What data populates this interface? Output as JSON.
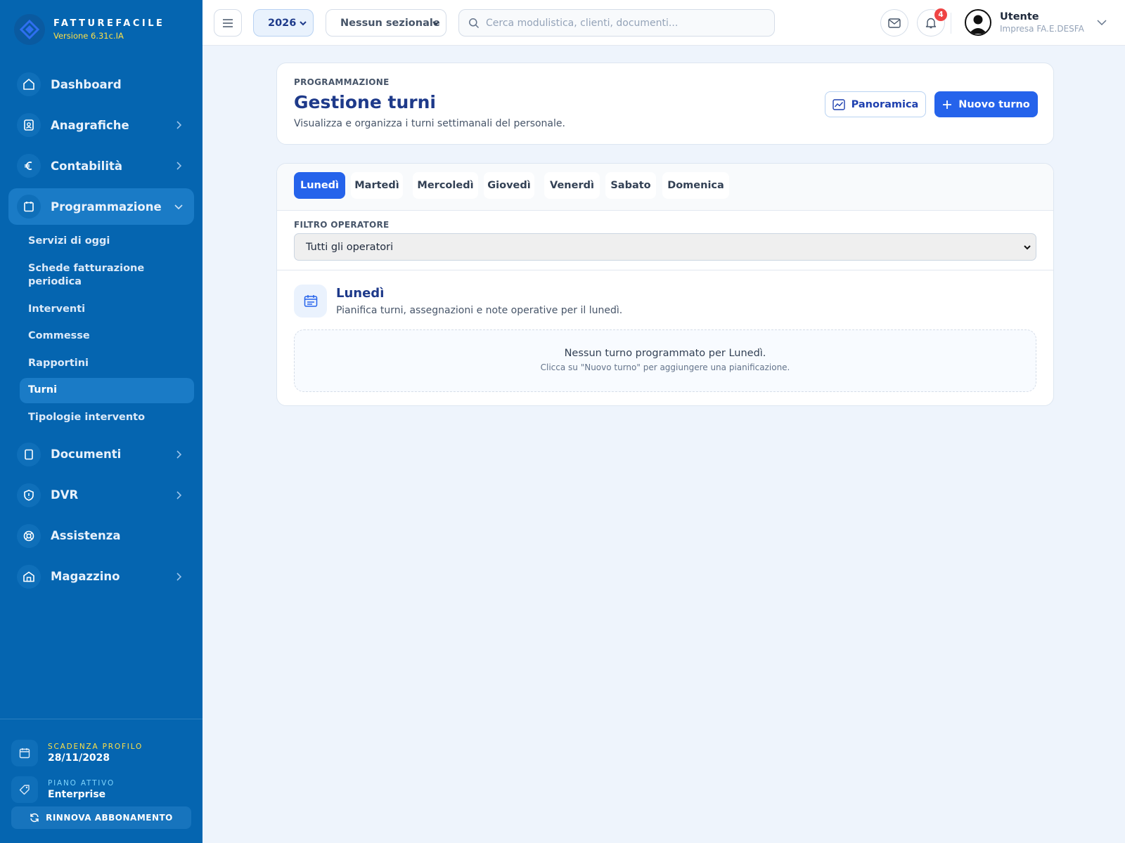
{
  "brand": {
    "name": "FATTUREFACILE",
    "version": "Versione 6.31c.IA"
  },
  "sidebar": {
    "items": [
      {
        "label": "Dashboard",
        "icon": "home-icon"
      },
      {
        "label": "Anagrafiche",
        "icon": "contact-card-icon"
      },
      {
        "label": "Contabilità",
        "icon": "euro-icon"
      },
      {
        "label": "Programmazione",
        "icon": "calendar-icon"
      },
      {
        "label": "Documenti",
        "icon": "document-icon"
      },
      {
        "label": "DVR",
        "icon": "shield-icon"
      },
      {
        "label": "Assistenza",
        "icon": "lifebuoy-icon"
      },
      {
        "label": "Magazzino",
        "icon": "warehouse-icon"
      }
    ],
    "subitems": [
      "Servizi di oggi",
      "Schede fatturazione periodica",
      "Interventi",
      "Commesse",
      "Rapportini",
      "Turni",
      "Tipologie intervento"
    ],
    "active_subitem": "Turni",
    "footer": {
      "expiry_label": "SCADENZA PROFILO",
      "expiry_value": "28/11/2028",
      "plan_label": "PIANO ATTIVO",
      "plan_value": "Enterprise",
      "renew_label": "RINNOVA ABBONAMENTO"
    }
  },
  "topbar": {
    "year": "2026",
    "sezionale": "Nessun sezionale",
    "search_placeholder": "Cerca modulistica, clienti, documenti...",
    "notifications_count": "4",
    "user_name": "Utente",
    "user_company": "Impresa FA.E.DESFA"
  },
  "header": {
    "eyebrow": "PROGRAMMAZIONE",
    "title": "Gestione turni",
    "subtitle": "Visualizza e organizza i turni settimanali del personale.",
    "overview_label": "Panoramica",
    "new_label": "Nuovo turno"
  },
  "tabs": [
    "Lunedì",
    "Martedì",
    "Mercoledì",
    "Giovedì",
    "Venerdì",
    "Sabato",
    "Domenica"
  ],
  "active_tab": "Lunedì",
  "filter": {
    "label": "FILTRO OPERATORE",
    "value": "Tutti gli operatori"
  },
  "day": {
    "title": "Lunedì",
    "subtitle": "Pianifica turni, assegnazioni e note operative per il lunedì.",
    "empty_title": "Nessun turno programmato per Lunedì.",
    "empty_subtitle": "Clicca su \"Nuovo turno\" per aggiungere una pianificazione."
  },
  "colors": {
    "sidebar": "#0565b0",
    "primary": "#2563eb",
    "accent_yellow": "#fde047",
    "badge": "#ef4444",
    "title": "#1e3a8a"
  }
}
